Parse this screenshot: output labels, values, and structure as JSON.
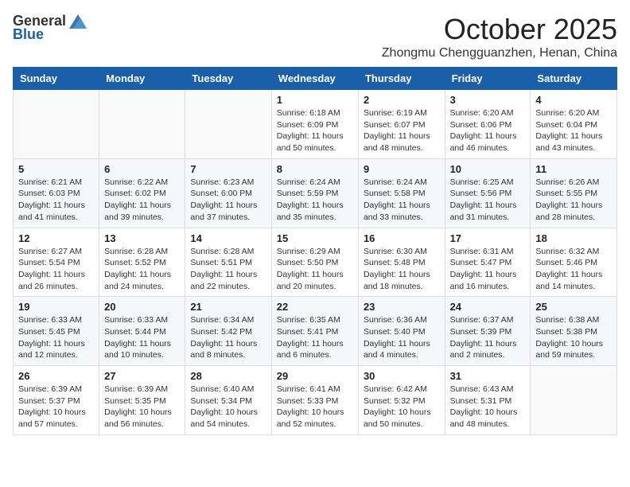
{
  "header": {
    "logo_general": "General",
    "logo_blue": "Blue",
    "month_title": "October 2025",
    "location": "Zhongmu Chengguanzhen, Henan, China"
  },
  "weekdays": [
    "Sunday",
    "Monday",
    "Tuesday",
    "Wednesday",
    "Thursday",
    "Friday",
    "Saturday"
  ],
  "weeks": [
    [
      {
        "day": "",
        "info": ""
      },
      {
        "day": "",
        "info": ""
      },
      {
        "day": "",
        "info": ""
      },
      {
        "day": "1",
        "info": "Sunrise: 6:18 AM\nSunset: 6:09 PM\nDaylight: 11 hours\nand 50 minutes."
      },
      {
        "day": "2",
        "info": "Sunrise: 6:19 AM\nSunset: 6:07 PM\nDaylight: 11 hours\nand 48 minutes."
      },
      {
        "day": "3",
        "info": "Sunrise: 6:20 AM\nSunset: 6:06 PM\nDaylight: 11 hours\nand 46 minutes."
      },
      {
        "day": "4",
        "info": "Sunrise: 6:20 AM\nSunset: 6:04 PM\nDaylight: 11 hours\nand 43 minutes."
      }
    ],
    [
      {
        "day": "5",
        "info": "Sunrise: 6:21 AM\nSunset: 6:03 PM\nDaylight: 11 hours\nand 41 minutes."
      },
      {
        "day": "6",
        "info": "Sunrise: 6:22 AM\nSunset: 6:02 PM\nDaylight: 11 hours\nand 39 minutes."
      },
      {
        "day": "7",
        "info": "Sunrise: 6:23 AM\nSunset: 6:00 PM\nDaylight: 11 hours\nand 37 minutes."
      },
      {
        "day": "8",
        "info": "Sunrise: 6:24 AM\nSunset: 5:59 PM\nDaylight: 11 hours\nand 35 minutes."
      },
      {
        "day": "9",
        "info": "Sunrise: 6:24 AM\nSunset: 5:58 PM\nDaylight: 11 hours\nand 33 minutes."
      },
      {
        "day": "10",
        "info": "Sunrise: 6:25 AM\nSunset: 5:56 PM\nDaylight: 11 hours\nand 31 minutes."
      },
      {
        "day": "11",
        "info": "Sunrise: 6:26 AM\nSunset: 5:55 PM\nDaylight: 11 hours\nand 28 minutes."
      }
    ],
    [
      {
        "day": "12",
        "info": "Sunrise: 6:27 AM\nSunset: 5:54 PM\nDaylight: 11 hours\nand 26 minutes."
      },
      {
        "day": "13",
        "info": "Sunrise: 6:28 AM\nSunset: 5:52 PM\nDaylight: 11 hours\nand 24 minutes."
      },
      {
        "day": "14",
        "info": "Sunrise: 6:28 AM\nSunset: 5:51 PM\nDaylight: 11 hours\nand 22 minutes."
      },
      {
        "day": "15",
        "info": "Sunrise: 6:29 AM\nSunset: 5:50 PM\nDaylight: 11 hours\nand 20 minutes."
      },
      {
        "day": "16",
        "info": "Sunrise: 6:30 AM\nSunset: 5:48 PM\nDaylight: 11 hours\nand 18 minutes."
      },
      {
        "day": "17",
        "info": "Sunrise: 6:31 AM\nSunset: 5:47 PM\nDaylight: 11 hours\nand 16 minutes."
      },
      {
        "day": "18",
        "info": "Sunrise: 6:32 AM\nSunset: 5:46 PM\nDaylight: 11 hours\nand 14 minutes."
      }
    ],
    [
      {
        "day": "19",
        "info": "Sunrise: 6:33 AM\nSunset: 5:45 PM\nDaylight: 11 hours\nand 12 minutes."
      },
      {
        "day": "20",
        "info": "Sunrise: 6:33 AM\nSunset: 5:44 PM\nDaylight: 11 hours\nand 10 minutes."
      },
      {
        "day": "21",
        "info": "Sunrise: 6:34 AM\nSunset: 5:42 PM\nDaylight: 11 hours\nand 8 minutes."
      },
      {
        "day": "22",
        "info": "Sunrise: 6:35 AM\nSunset: 5:41 PM\nDaylight: 11 hours\nand 6 minutes."
      },
      {
        "day": "23",
        "info": "Sunrise: 6:36 AM\nSunset: 5:40 PM\nDaylight: 11 hours\nand 4 minutes."
      },
      {
        "day": "24",
        "info": "Sunrise: 6:37 AM\nSunset: 5:39 PM\nDaylight: 11 hours\nand 2 minutes."
      },
      {
        "day": "25",
        "info": "Sunrise: 6:38 AM\nSunset: 5:38 PM\nDaylight: 10 hours\nand 59 minutes."
      }
    ],
    [
      {
        "day": "26",
        "info": "Sunrise: 6:39 AM\nSunset: 5:37 PM\nDaylight: 10 hours\nand 57 minutes."
      },
      {
        "day": "27",
        "info": "Sunrise: 6:39 AM\nSunset: 5:35 PM\nDaylight: 10 hours\nand 56 minutes."
      },
      {
        "day": "28",
        "info": "Sunrise: 6:40 AM\nSunset: 5:34 PM\nDaylight: 10 hours\nand 54 minutes."
      },
      {
        "day": "29",
        "info": "Sunrise: 6:41 AM\nSunset: 5:33 PM\nDaylight: 10 hours\nand 52 minutes."
      },
      {
        "day": "30",
        "info": "Sunrise: 6:42 AM\nSunset: 5:32 PM\nDaylight: 10 hours\nand 50 minutes."
      },
      {
        "day": "31",
        "info": "Sunrise: 6:43 AM\nSunset: 5:31 PM\nDaylight: 10 hours\nand 48 minutes."
      },
      {
        "day": "",
        "info": ""
      }
    ]
  ]
}
